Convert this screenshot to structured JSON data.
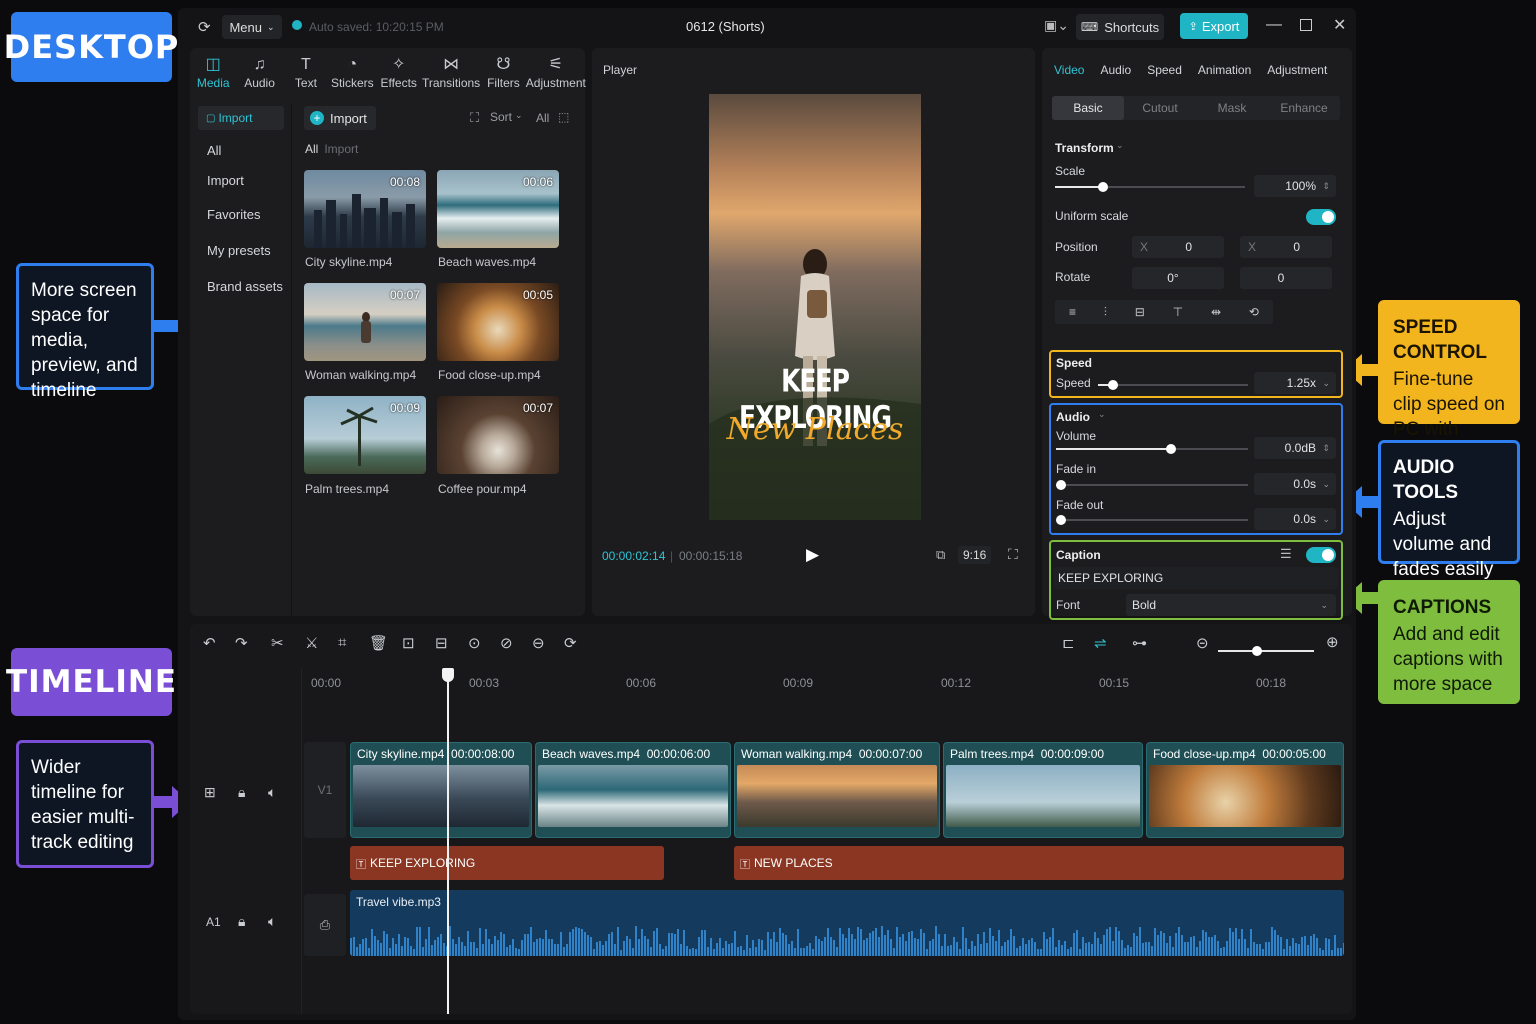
{
  "annotations": {
    "desktop": "DESKTOP",
    "timeline": "TIMELINE",
    "more_space": "More screen space for media, preview, and timeline",
    "wider_timeline": "Wider timeline for easier multi-track editing",
    "speed_title": "SPEED CONTROL",
    "speed_body": "Fine-tune clip speed on PC with precision",
    "audio_title": "AUDIO TOOLS",
    "audio_body": "Adjust volume and fades easily",
    "captions_title": "CAPTIONS",
    "captions_body": "Add and edit captions with more space"
  },
  "topbar": {
    "menu": "Menu",
    "autosave": "Auto saved: 10:20:15 PM",
    "project_title": "0612 (Shorts)",
    "shortcuts": "Shortcuts",
    "export": "Export"
  },
  "media_tabs": [
    {
      "label": "Media",
      "icon": "media-icon"
    },
    {
      "label": "Audio",
      "icon": "audio-icon"
    },
    {
      "label": "Text",
      "icon": "text-icon"
    },
    {
      "label": "Stickers",
      "icon": "stickers-icon"
    },
    {
      "label": "Effects",
      "icon": "effects-icon"
    },
    {
      "label": "Transitions",
      "icon": "transitions-icon"
    },
    {
      "label": "Filters",
      "icon": "filters-icon"
    },
    {
      "label": "Adjustment",
      "icon": "adjustment-icon"
    }
  ],
  "media_sidebar": {
    "import_tab": "Import",
    "items": [
      "All",
      "Import",
      "Favorites",
      "My presets",
      "Brand assets"
    ]
  },
  "media_toolbar": {
    "import": "Import",
    "sort": "Sort",
    "all": "All"
  },
  "media_filter": {
    "all": "All",
    "import": "Import"
  },
  "media_files": [
    {
      "name": "City skyline.mp4",
      "duration": "00:08"
    },
    {
      "name": "Beach waves.mp4",
      "duration": "00:06"
    },
    {
      "name": "Woman walking.mp4",
      "duration": "00:07"
    },
    {
      "name": "Food close-up.mp4",
      "duration": "00:05"
    },
    {
      "name": "Palm trees.mp4",
      "duration": "00:09"
    },
    {
      "name": "Coffee pour.mp4",
      "duration": "00:07"
    }
  ],
  "player": {
    "label": "Player",
    "overlay_title": "KEEP EXPLORING",
    "overlay_sub": "New Places",
    "current_time": "00:00:02:14",
    "total_time": "00:00:15:18",
    "ratio": "9:16"
  },
  "right_tabs": [
    "Video",
    "Audio",
    "Speed",
    "Animation",
    "Adjustment"
  ],
  "sub_tabs": [
    "Basic",
    "Cutout",
    "Mask",
    "Enhance"
  ],
  "transform": {
    "title": "Transform",
    "scale_label": "Scale",
    "scale_value": "100%",
    "scale_level": 0.25,
    "uniform_label": "Uniform scale",
    "position_label": "Position",
    "pos_x_label": "X",
    "pos_x": "0",
    "pos_y_label": "X",
    "pos_y": "0",
    "rotate_label": "Rotate",
    "rotate_value": "0°",
    "rotate_value2": "0"
  },
  "speed": {
    "title": "Speed",
    "label": "Speed",
    "value": "1.25x",
    "level": 0.1
  },
  "audio": {
    "title": "Audio",
    "volume_label": "Volume",
    "volume_value": "0.0dB",
    "volume_level": 0.6,
    "fade_in_label": "Fade in",
    "fade_in_value": "0.0s",
    "fade_out_label": "Fade out",
    "fade_out_value": "0.0s"
  },
  "caption": {
    "title": "Caption",
    "text": "KEEP EXPLORING",
    "font_label": "Font",
    "font_value": "Bold"
  },
  "ruler": [
    "00:00",
    "00:03",
    "00:06",
    "00:09",
    "00:12",
    "00:15",
    "00:18"
  ],
  "tracks": {
    "video_label": "V1",
    "audio_label": "A1"
  },
  "video_clips": [
    {
      "name": "City skyline.mp4",
      "duration": "00:00:08:00"
    },
    {
      "name": "Beach waves.mp4",
      "duration": "00:00:06:00"
    },
    {
      "name": "Woman walking.mp4",
      "duration": "00:00:07:00"
    },
    {
      "name": "Palm trees.mp4",
      "duration": "00:00:09:00"
    },
    {
      "name": "Food close-up.mp4",
      "duration": "00:00:05:00"
    }
  ],
  "caption_clips": [
    "KEEP EXPLORING",
    "NEW PLACES"
  ],
  "audio_clip": "Travel vibe.mp3",
  "colors": {
    "accent": "#2fc3d3",
    "speed_box": "#f2b51d",
    "audio_box": "#2f7ef0",
    "caption_box": "#7fbd3f",
    "desktop_badge": "#2f7ef0",
    "timeline_badge": "#7a4fd6"
  }
}
